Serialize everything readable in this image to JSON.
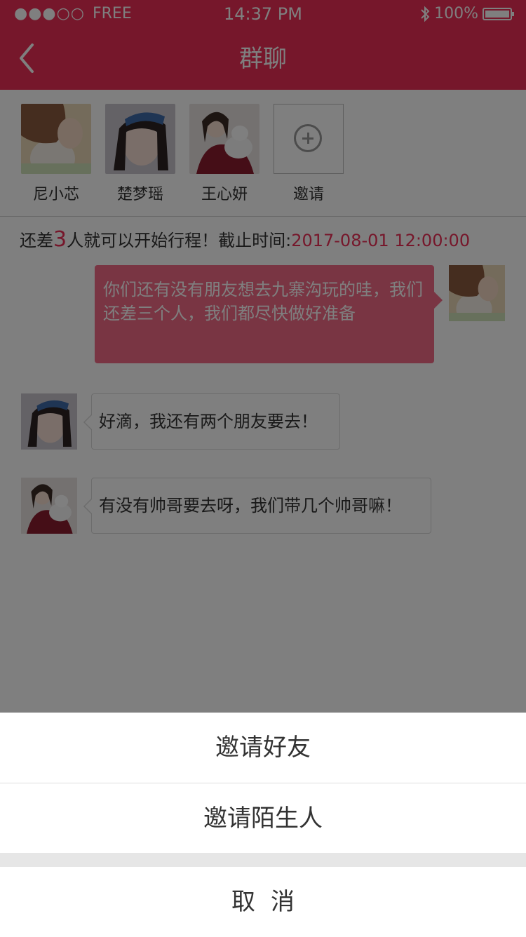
{
  "status_bar": {
    "carrier": "FREE",
    "time": "14:37 PM",
    "battery_text": "100%",
    "signal_icon": "signal-dots-icon",
    "bluetooth_icon": "bluetooth-icon",
    "battery_icon": "battery-icon"
  },
  "header": {
    "title": "群聊",
    "back_icon": "chevron-left-icon"
  },
  "members": {
    "items": [
      {
        "name": "尼小芯"
      },
      {
        "name": "楚梦瑶"
      },
      {
        "name": "王心妍"
      }
    ],
    "invite_label": "邀请",
    "invite_icon": "plus-circle-icon"
  },
  "notice": {
    "prefix": "还差",
    "count": "3",
    "middle": "人就可以开始行程！截止时间:",
    "deadline": "2017-08-01 12:00:00"
  },
  "messages": [
    {
      "text": "你们还有没有朋友想去九寨沟玩的哇，我们还差三个人，我们都尽快做好准备"
    },
    {
      "text": "好滴，我还有两个朋友要去！"
    },
    {
      "text": "有没有帅哥要去呀，我们带几个帅哥嘛！"
    }
  ],
  "action_sheet": {
    "items": [
      "邀请好友",
      "邀请陌生人"
    ],
    "cancel": "取消"
  },
  "colors": {
    "accent": "#ed2f57",
    "bubble_pink": "#f26b87"
  }
}
